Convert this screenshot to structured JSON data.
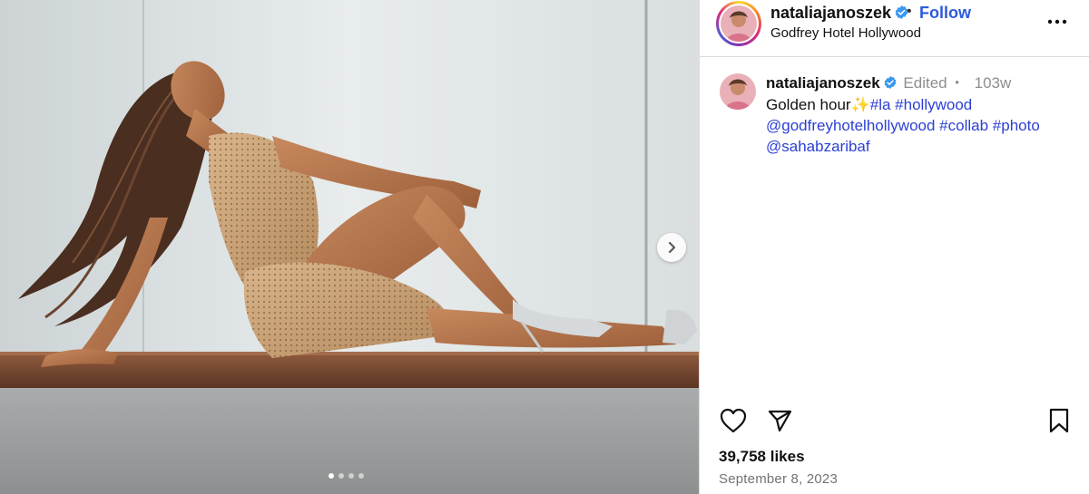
{
  "post": {
    "username": "nataliajanoszek",
    "separator": "•",
    "follow_label": "Follow",
    "location": "Godfrey Hotel Hollywood",
    "more_icon": "more-horizontal-icon",
    "verified_color": "#3897f0"
  },
  "caption": {
    "username": "nataliajanoszek",
    "edited_label": "Edited",
    "bullet": "•",
    "time_ago": "103w",
    "text": "Golden hour",
    "sparkle_emoji": "✨",
    "tags": [
      {
        "text": "#la"
      },
      {
        "text": "#hollywood"
      },
      {
        "text": "@godfreyhotelhollywood"
      },
      {
        "text": "#collab"
      },
      {
        "text": "#photo"
      },
      {
        "text": "@sahabzaribaf"
      }
    ],
    "link_color": "#2c3fd4"
  },
  "actions": {
    "like_icon": "heart-icon",
    "share_icon": "send-icon",
    "save_icon": "bookmark-icon"
  },
  "stats": {
    "likes": "39,758 likes",
    "date": "September 8, 2023"
  },
  "carousel": {
    "slide_count": 4,
    "active_index": 0,
    "next_icon": "chevron-right-icon"
  },
  "colors": {
    "follow": "#2c5bdc",
    "muted": "#8e8e8e",
    "border": "#dbdbdb"
  }
}
